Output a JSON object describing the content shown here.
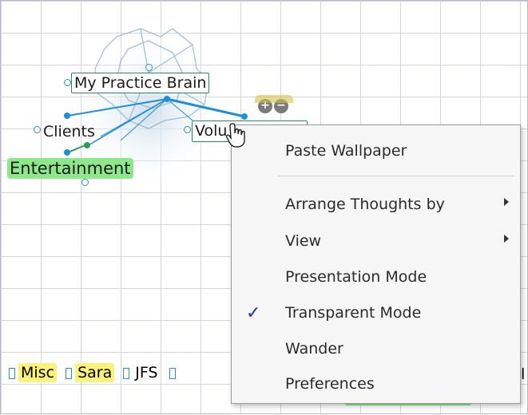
{
  "thoughts": {
    "central": "My Practice Brain",
    "clients": "Clients",
    "entertainment": "Entertainment",
    "volunteer_partial": "Volu"
  },
  "expand_controls": {
    "plus": "+",
    "minus": "−"
  },
  "plex": [
    {
      "label": "Misc",
      "highlight": true
    },
    {
      "label": "Sara",
      "highlight": true
    },
    {
      "label": "JFS",
      "highlight": false
    }
  ],
  "plex_trailing": "l",
  "context_menu": {
    "paste_wallpaper": "Paste Wallpaper",
    "arrange_thoughts_by": "Arrange Thoughts by",
    "view": "View",
    "presentation_mode": "Presentation Mode",
    "transparent_mode": "Transparent Mode",
    "transparent_checked": "✓",
    "wander": "Wander",
    "preferences": "Preferences"
  },
  "colors": {
    "link": "#1f8fd6",
    "entertainment_bg": "#8de88a",
    "plex_highlight": "#fbf27a",
    "check": "#2233aa"
  }
}
